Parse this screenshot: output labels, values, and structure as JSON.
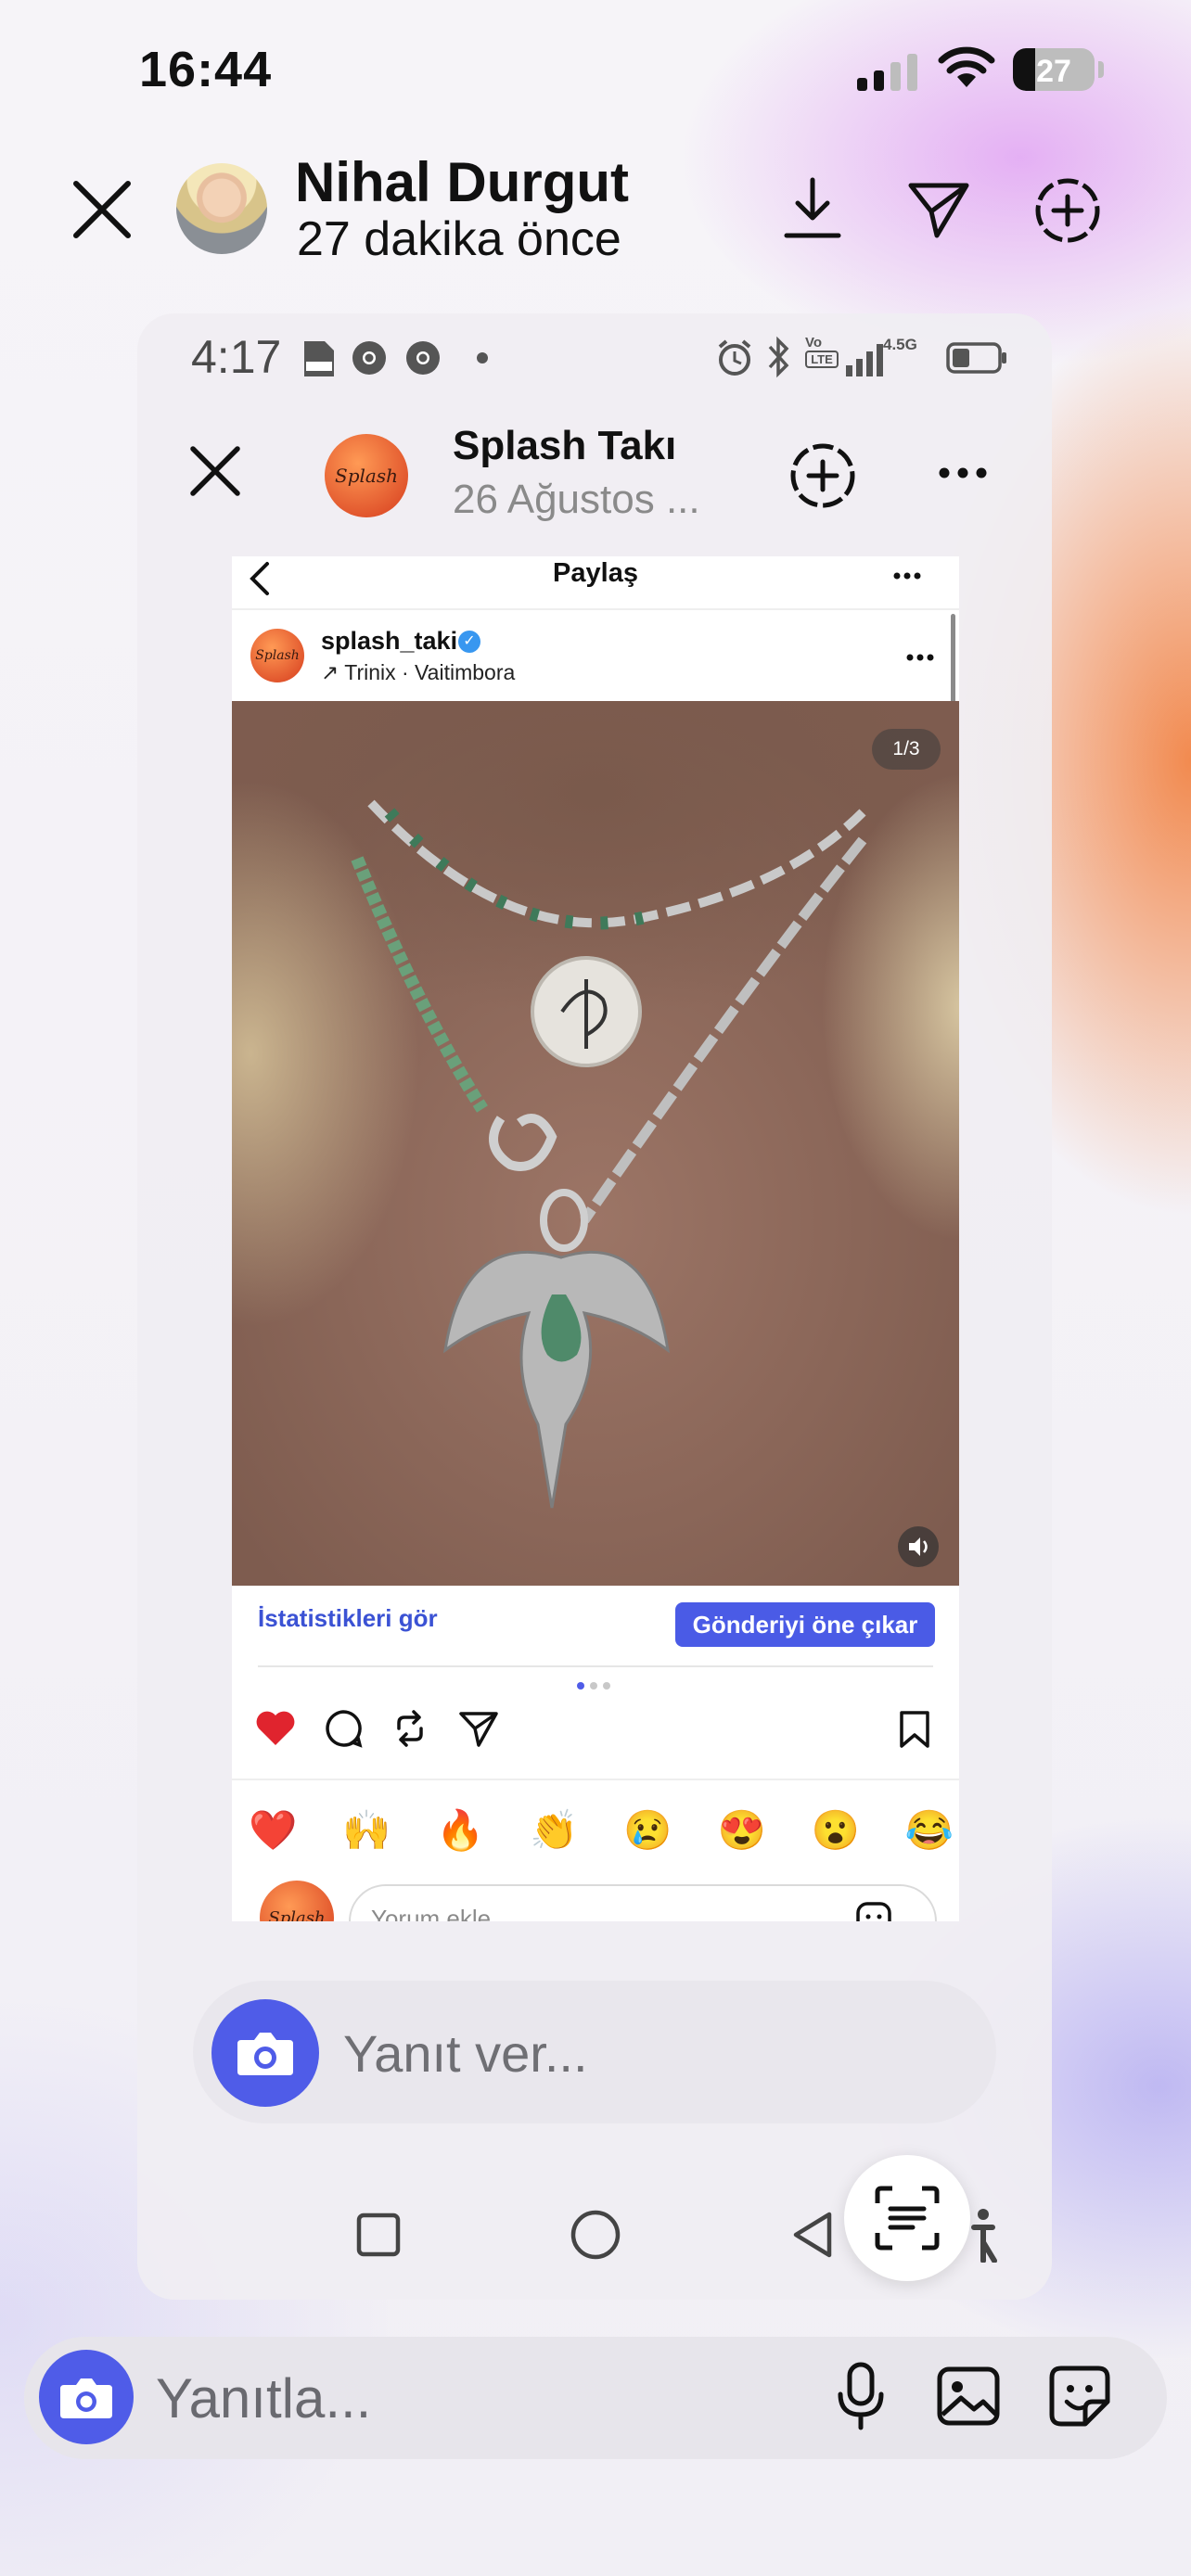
{
  "status_bar": {
    "time": "16:44",
    "battery": "27",
    "battery_level": 0.27
  },
  "story": {
    "user_name": "Nihal Durgut",
    "time_ago": "27 dakika önce"
  },
  "inner": {
    "status_time": "4:17",
    "network_label": "4.5G",
    "volte_label": "LTE",
    "story_user": "Splash Takı",
    "story_date": "26 Ağustos ...",
    "avatar_text": "Splash"
  },
  "post": {
    "header_title": "Paylaş",
    "username": "splash_taki",
    "verified_mark": "✓",
    "subtitle": "↗ Trinix · Vaitimbora",
    "counter": "1/3",
    "stats_link": "İstatistikleri gör",
    "boost_button": "Gönderiyi öne çıkar",
    "carousel_pages": 3,
    "carousel_active": 1,
    "emojis": [
      "❤️",
      "🙌",
      "🔥",
      "👏",
      "😢",
      "😍",
      "😮",
      "😂"
    ],
    "comment_placeholder": "Yorum ekle"
  },
  "reply_inner": {
    "placeholder": "Yanıt ver..."
  },
  "reply_bar": {
    "placeholder": "Yanıtla..."
  },
  "colors": {
    "accent": "#4f5ce8",
    "link": "#3b52d4",
    "like": "#e0242e"
  },
  "icons": [
    "close-icon",
    "download-icon",
    "send-icon",
    "add-story-icon",
    "more-icon",
    "camera-icon",
    "mic-icon",
    "gallery-icon",
    "sticker-icon",
    "heart-icon",
    "comment-icon",
    "repost-icon",
    "bookmark-icon",
    "lens-icon"
  ]
}
